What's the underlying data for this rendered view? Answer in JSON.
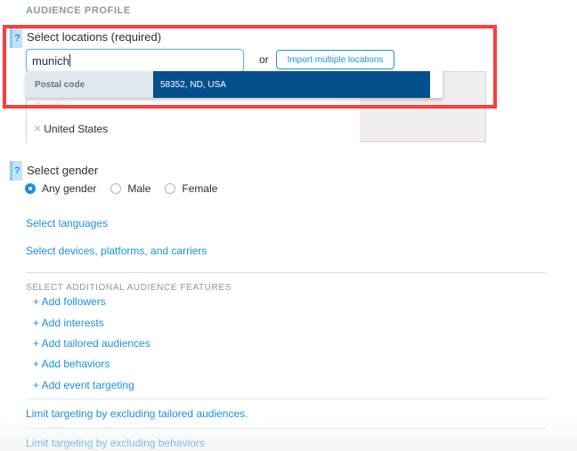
{
  "section_title": "AUDIENCE PROFILE",
  "locations": {
    "help_icon": "?",
    "label": "Select locations (required)",
    "input_value": "munich",
    "or_text": "or",
    "import_button": "Import multiple locations",
    "dropdown": {
      "type_label": "Postal code",
      "option": "58352, ND, USA"
    },
    "selected": {
      "group_label": "Country",
      "remove_icon": "×",
      "value": "United States"
    }
  },
  "gender": {
    "help_icon": "?",
    "label": "Select gender",
    "options": [
      {
        "label": "Any gender",
        "selected": true
      },
      {
        "label": "Male",
        "selected": false
      },
      {
        "label": "Female",
        "selected": false
      }
    ]
  },
  "links": {
    "languages": "Select languages",
    "devices": "Select devices, platforms, and carriers"
  },
  "additional": {
    "title": "SELECT ADDITIONAL AUDIENCE FEATURES",
    "items": [
      "+ Add followers",
      "+ Add interests",
      "+ Add tailored audiences",
      "+ Add behaviors",
      "+ Add event targeting"
    ]
  },
  "exclusions": {
    "tailored": "Limit targeting by excluding tailored audiences.",
    "behaviors": "Limit targeting by excluding behaviors"
  },
  "colors": {
    "accent": "#1d91d9",
    "dropdown_selected": "#03508c",
    "highlight": "#ff3b3b"
  }
}
